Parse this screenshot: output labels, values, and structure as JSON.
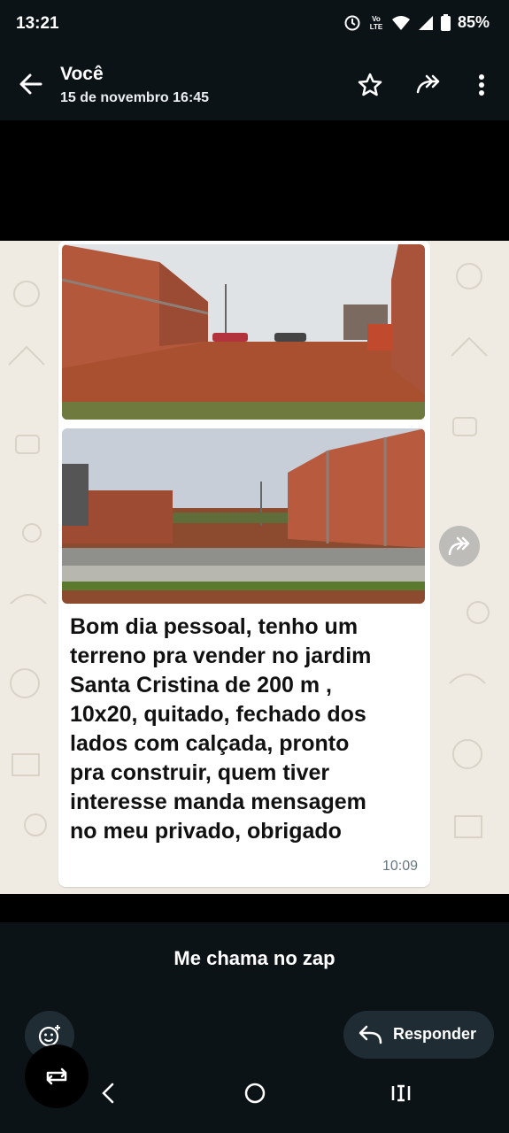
{
  "status_bar": {
    "time": "13:21",
    "network": "Vo LTE",
    "battery": "85%",
    "icons": [
      "alarm-icon",
      "volte-icon",
      "wifi-icon",
      "signal-icon",
      "battery-icon"
    ]
  },
  "header": {
    "title": "Você",
    "subtitle": "15 de novembro 16:45",
    "actions": [
      "back-arrow-icon",
      "star-icon",
      "forward-icon",
      "more-vertical-icon"
    ]
  },
  "message": {
    "images": [
      "photo-empty-lot-1",
      "photo-empty-lot-2"
    ],
    "text": "Bom dia pessoal, tenho um terreno pra vender no jardim Santa Cristina de 200 m , 10x20, quitado, fechado dos lados com calçada, pronto pra construir, quem tiver interesse manda mensagem no meu privado, obrigado",
    "lines": [
      "Bom dia pessoal, tenho um",
      "terreno pra vender no jardim",
      "Santa Cristina de 200 m ,",
      "10x20, quitado, fechado dos",
      "lados com calçada, pronto",
      "pra construir, quem tiver",
      "interesse manda mensagem",
      "no meu privado, obrigado"
    ],
    "time": "10:09"
  },
  "footer": {
    "caption": "Me chama no zap",
    "reply_label": "Responder"
  },
  "colors": {
    "dark_bg": "#0c1317",
    "chat_bg": "#efeae2",
    "bubble": "#ffffff",
    "button_bg": "#202c33"
  }
}
